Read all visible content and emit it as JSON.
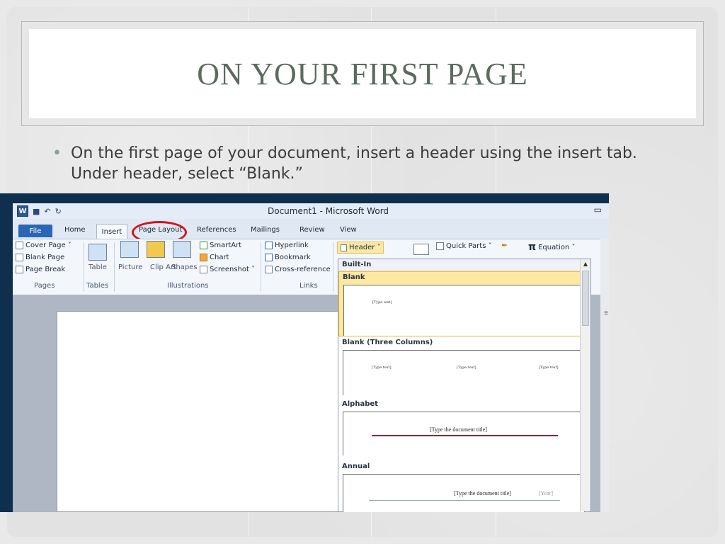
{
  "slide": {
    "title": "ON YOUR FIRST PAGE",
    "bullet": "On the first page of your document, insert a header using the insert tab. Under header, select “Blank.”",
    "bullet_marker": "•"
  },
  "word": {
    "window_title": "Document1 - Microsoft Word",
    "tabs": [
      "File",
      "Home",
      "Insert",
      "Page Layout",
      "References",
      "Mailings",
      "Review",
      "View"
    ],
    "ribbon": {
      "pages": {
        "items": [
          "Cover Page ˅",
          "Blank Page",
          "Page Break"
        ],
        "label": "Pages"
      },
      "tables": {
        "item": "Table",
        "label": "Tables"
      },
      "illustrations": {
        "items": [
          "Picture",
          "Clip Art",
          "Shapes"
        ],
        "small_items": [
          "SmartArt",
          "Chart",
          "Screenshot ˅"
        ],
        "label": "Illustrations"
      },
      "links": {
        "items": [
          "Hyperlink",
          "Bookmark",
          "Cross-reference"
        ],
        "label": "Links"
      },
      "header_button": "Header ˅",
      "quick_parts": "Quick Parts ˅",
      "equation": "Equation ˅",
      "pi": "π"
    },
    "header_gallery": {
      "section": "Built-In",
      "items": [
        {
          "name": "Blank",
          "placeholders": [
            "[Type text]"
          ]
        },
        {
          "name": "Blank (Three Columns)",
          "placeholders": [
            "[Type text]",
            "[Type text]",
            "[Type text]"
          ]
        },
        {
          "name": "Alphabet",
          "placeholders": [
            "[Type the document title]"
          ]
        },
        {
          "name": "Annual",
          "placeholders": [
            "[Type the document title]",
            "[Year]"
          ]
        }
      ]
    }
  }
}
